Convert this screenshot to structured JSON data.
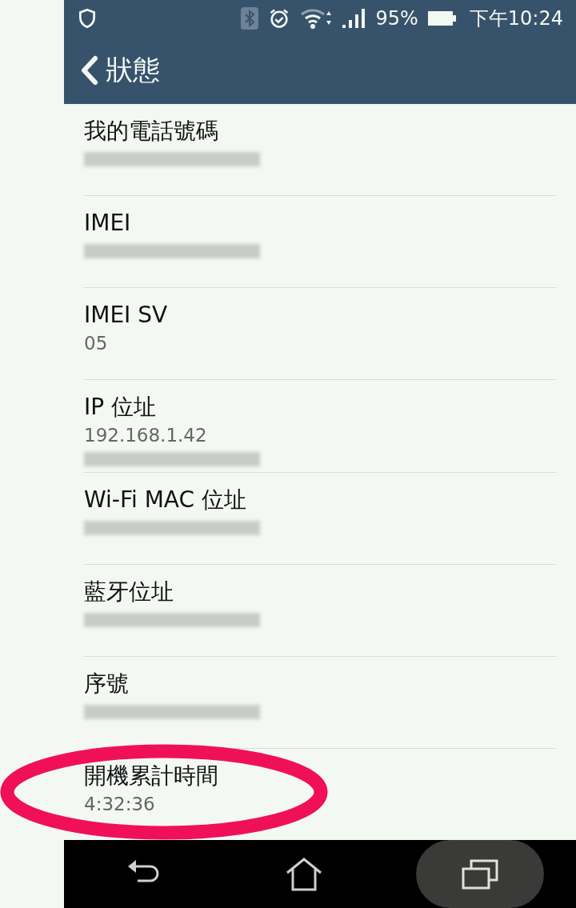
{
  "status_bar": {
    "battery": "95%",
    "time": "下午10:24"
  },
  "app_bar": {
    "title": "狀態"
  },
  "items": [
    {
      "label": "我的電話號碼",
      "values": [
        {
          "kind": "redacted"
        }
      ]
    },
    {
      "label": "IMEI",
      "values": [
        {
          "kind": "redacted"
        }
      ]
    },
    {
      "label": "IMEI SV",
      "values": [
        {
          "kind": "text",
          "text": "05"
        }
      ]
    },
    {
      "label": "IP 位址",
      "values": [
        {
          "kind": "text",
          "text": "192.168.1.42"
        },
        {
          "kind": "redacted"
        }
      ]
    },
    {
      "label": "Wi-Fi MAC 位址",
      "values": [
        {
          "kind": "redacted"
        }
      ]
    },
    {
      "label": "藍牙位址",
      "values": [
        {
          "kind": "redacted"
        }
      ]
    },
    {
      "label": "序號",
      "values": [
        {
          "kind": "redacted"
        }
      ]
    },
    {
      "label": "開機累計時間",
      "values": [
        {
          "kind": "text",
          "text": "4:32:36"
        }
      ]
    }
  ],
  "annotation": {
    "kind": "ellipse"
  }
}
